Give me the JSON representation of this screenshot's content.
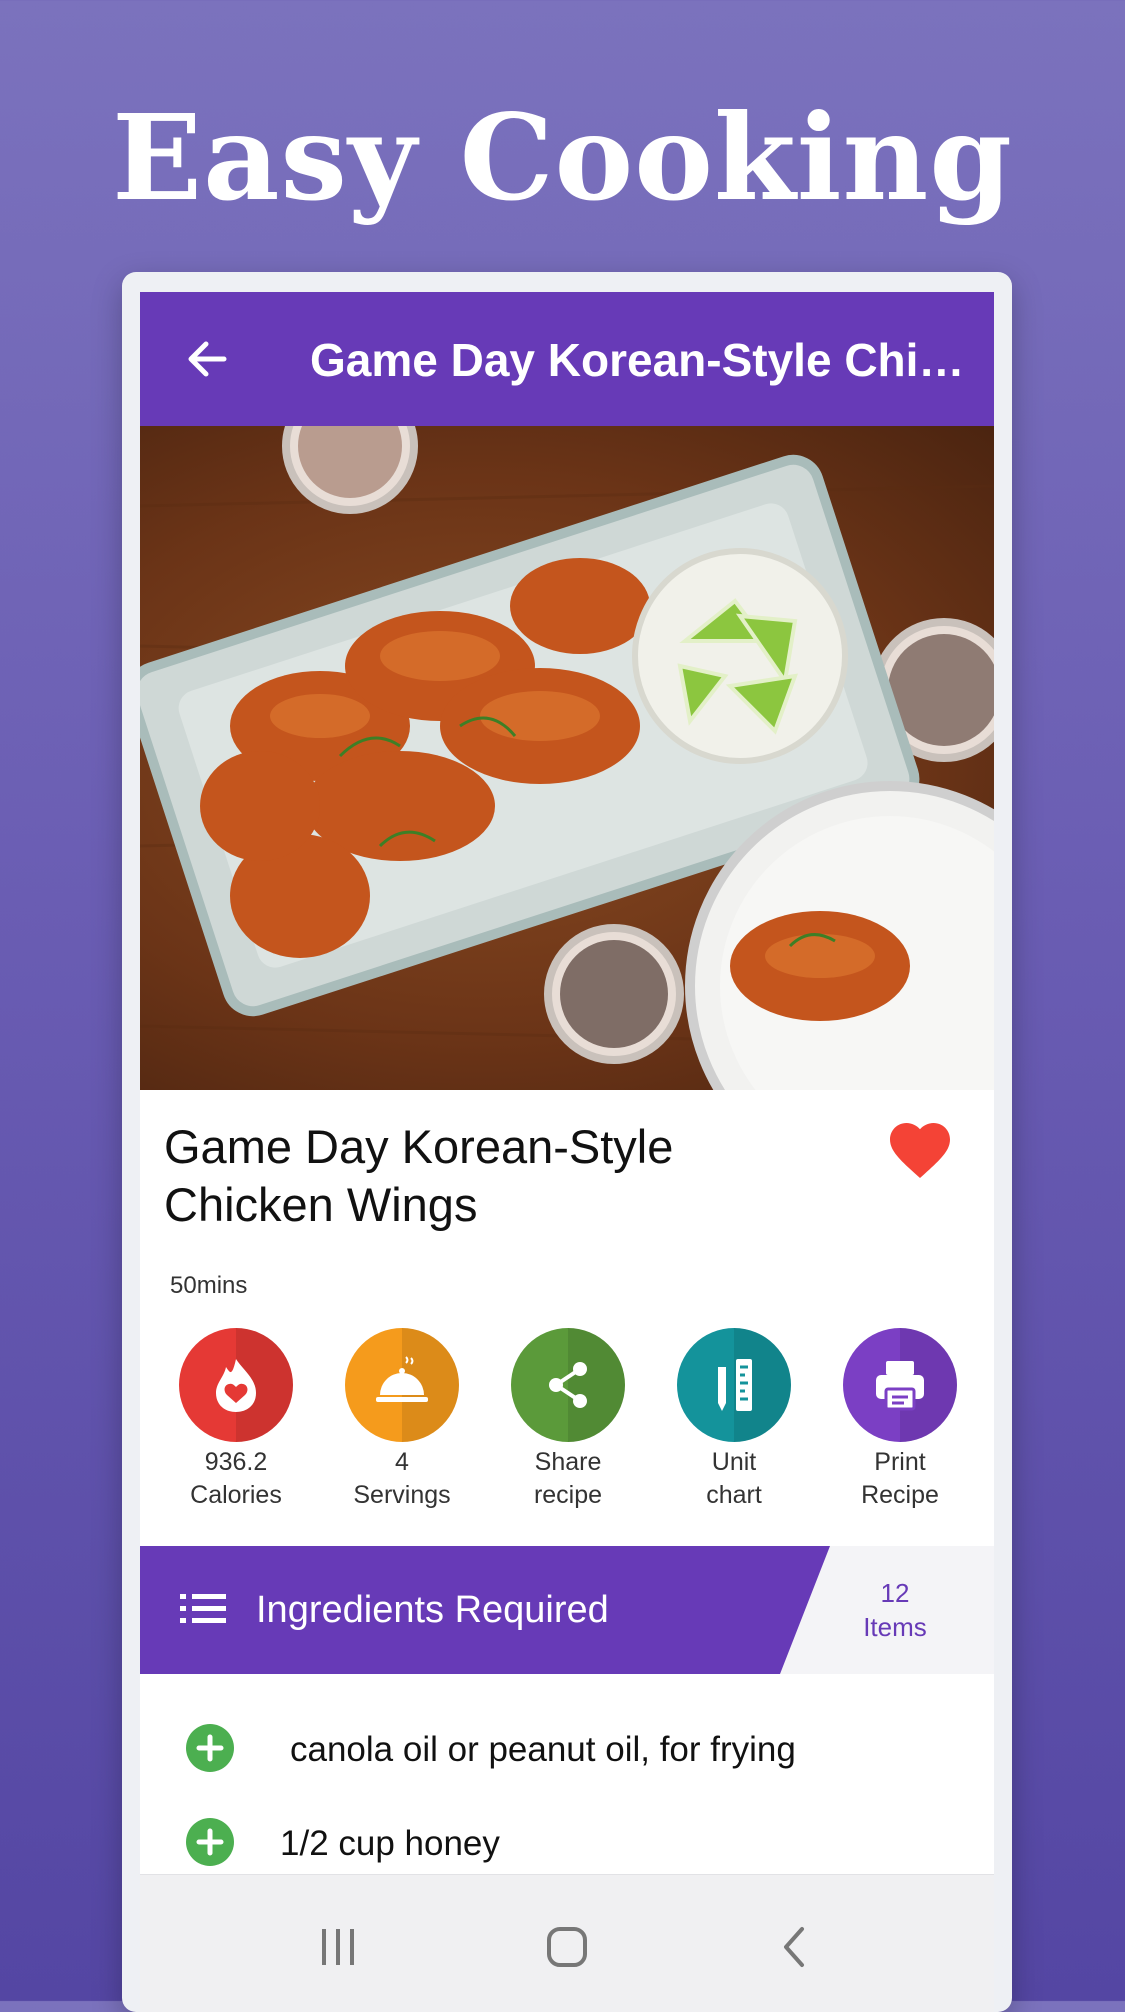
{
  "promo": {
    "title": "Easy Cooking"
  },
  "appbar": {
    "title": "Game Day Korean-Style Chick..."
  },
  "recipe": {
    "title_line1": "Game Day Korean-Style",
    "title_line2": "Chicken Wings",
    "duration": "50mins",
    "favorite": true
  },
  "actions": [
    {
      "line1": "936.2",
      "line2": "Calories",
      "icon": "calorie-heart-icon",
      "color": "#e53935"
    },
    {
      "line1": "4",
      "line2": "Servings",
      "icon": "cloche-icon",
      "color": "#f59b1c"
    },
    {
      "line1": "Share",
      "line2": "recipe",
      "icon": "share-icon",
      "color": "#5b9a3a"
    },
    {
      "line1": "Unit",
      "line2": "chart",
      "icon": "ruler-icon",
      "color": "#14939b"
    },
    {
      "line1": "Print",
      "line2": "Recipe",
      "icon": "printer-icon",
      "color": "#7b3fc4"
    }
  ],
  "ingredients": {
    "header": "Ingredients Required",
    "count_number": "12",
    "count_label": "Items",
    "items": [
      "canola oil or peanut oil, for frying",
      "1/2 cup honey"
    ]
  },
  "colors": {
    "primary": "#673ab7",
    "favorite": "#f44336",
    "plus": "#4caf50"
  },
  "navbar": {
    "icons": [
      "recent-apps-icon",
      "home-icon",
      "back-nav-icon"
    ]
  }
}
